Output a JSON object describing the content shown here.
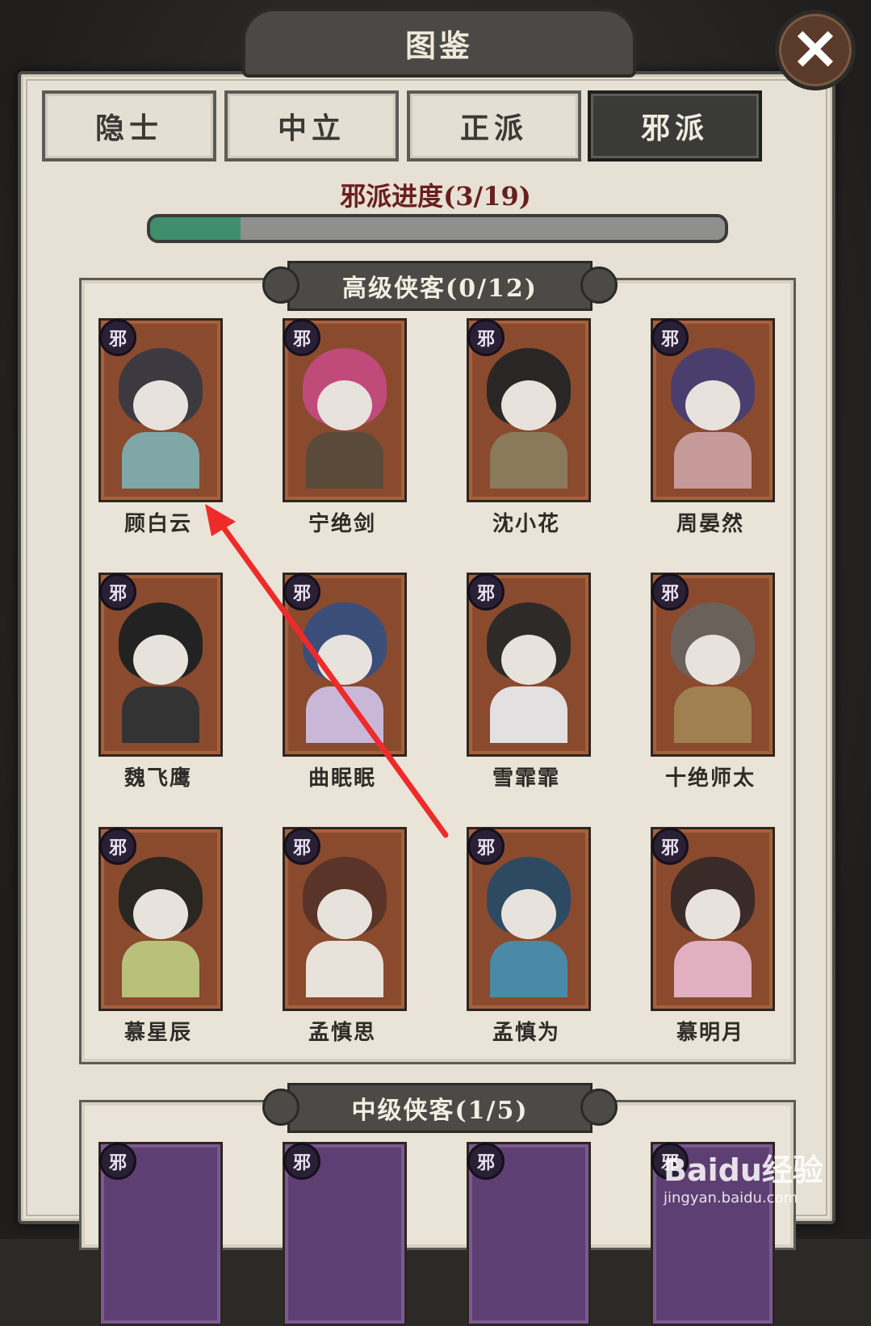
{
  "window_title": "图鉴",
  "close_label": "✕",
  "tabs": [
    {
      "label": "隐士",
      "active": false
    },
    {
      "label": "中立",
      "active": false
    },
    {
      "label": "正派",
      "active": false
    },
    {
      "label": "邪派",
      "active": true
    }
  ],
  "progress": {
    "label": "邪派进度(3/19)",
    "fraction": 0.158,
    "color": "#3f8f6d"
  },
  "sections": [
    {
      "label": "高级侠客(0/12)",
      "characters": [
        {
          "name": "顾白云",
          "badge": "邪"
        },
        {
          "name": "宁绝剑",
          "badge": "邪"
        },
        {
          "name": "沈小花",
          "badge": "邪"
        },
        {
          "name": "周晏然",
          "badge": "邪"
        },
        {
          "name": "魏飞鹰",
          "badge": "邪"
        },
        {
          "name": "曲眠眠",
          "badge": "邪"
        },
        {
          "name": "雪霏霏",
          "badge": "邪"
        },
        {
          "name": "十绝师太",
          "badge": "邪"
        },
        {
          "name": "慕星辰",
          "badge": "邪"
        },
        {
          "name": "孟慎思",
          "badge": "邪"
        },
        {
          "name": "孟慎为",
          "badge": "邪"
        },
        {
          "name": "慕明月",
          "badge": "邪"
        }
      ]
    },
    {
      "label": "中级侠客(1/5)",
      "characters": [
        {
          "badge": "邪"
        },
        {
          "badge": "邪"
        },
        {
          "badge": "邪"
        },
        {
          "badge": "邪"
        }
      ]
    }
  ],
  "watermark": {
    "logo": "Baidu经验",
    "site": "jingyan.baidu.com"
  }
}
